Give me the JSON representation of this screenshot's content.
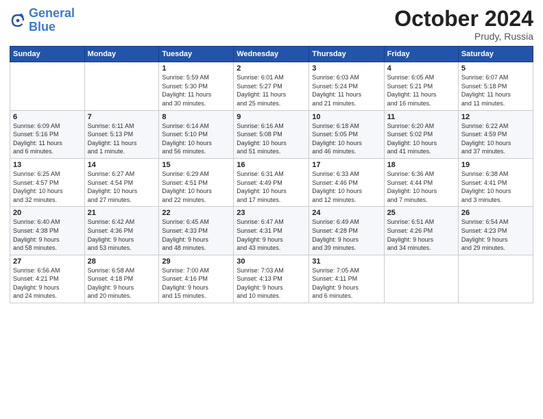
{
  "logo": {
    "line1": "General",
    "line2": "Blue"
  },
  "title": "October 2024",
  "location": "Prudy, Russia",
  "days_header": [
    "Sunday",
    "Monday",
    "Tuesday",
    "Wednesday",
    "Thursday",
    "Friday",
    "Saturday"
  ],
  "weeks": [
    [
      {
        "day": "",
        "info": ""
      },
      {
        "day": "",
        "info": ""
      },
      {
        "day": "1",
        "info": "Sunrise: 5:59 AM\nSunset: 5:30 PM\nDaylight: 11 hours\nand 30 minutes."
      },
      {
        "day": "2",
        "info": "Sunrise: 6:01 AM\nSunset: 5:27 PM\nDaylight: 11 hours\nand 25 minutes."
      },
      {
        "day": "3",
        "info": "Sunrise: 6:03 AM\nSunset: 5:24 PM\nDaylight: 11 hours\nand 21 minutes."
      },
      {
        "day": "4",
        "info": "Sunrise: 6:05 AM\nSunset: 5:21 PM\nDaylight: 11 hours\nand 16 minutes."
      },
      {
        "day": "5",
        "info": "Sunrise: 6:07 AM\nSunset: 5:18 PM\nDaylight: 11 hours\nand 11 minutes."
      }
    ],
    [
      {
        "day": "6",
        "info": "Sunrise: 6:09 AM\nSunset: 5:16 PM\nDaylight: 11 hours\nand 6 minutes."
      },
      {
        "day": "7",
        "info": "Sunrise: 6:11 AM\nSunset: 5:13 PM\nDaylight: 11 hours\nand 1 minute."
      },
      {
        "day": "8",
        "info": "Sunrise: 6:14 AM\nSunset: 5:10 PM\nDaylight: 10 hours\nand 56 minutes."
      },
      {
        "day": "9",
        "info": "Sunrise: 6:16 AM\nSunset: 5:08 PM\nDaylight: 10 hours\nand 51 minutes."
      },
      {
        "day": "10",
        "info": "Sunrise: 6:18 AM\nSunset: 5:05 PM\nDaylight: 10 hours\nand 46 minutes."
      },
      {
        "day": "11",
        "info": "Sunrise: 6:20 AM\nSunset: 5:02 PM\nDaylight: 10 hours\nand 41 minutes."
      },
      {
        "day": "12",
        "info": "Sunrise: 6:22 AM\nSunset: 4:59 PM\nDaylight: 10 hours\nand 37 minutes."
      }
    ],
    [
      {
        "day": "13",
        "info": "Sunrise: 6:25 AM\nSunset: 4:57 PM\nDaylight: 10 hours\nand 32 minutes."
      },
      {
        "day": "14",
        "info": "Sunrise: 6:27 AM\nSunset: 4:54 PM\nDaylight: 10 hours\nand 27 minutes."
      },
      {
        "day": "15",
        "info": "Sunrise: 6:29 AM\nSunset: 4:51 PM\nDaylight: 10 hours\nand 22 minutes."
      },
      {
        "day": "16",
        "info": "Sunrise: 6:31 AM\nSunset: 4:49 PM\nDaylight: 10 hours\nand 17 minutes."
      },
      {
        "day": "17",
        "info": "Sunrise: 6:33 AM\nSunset: 4:46 PM\nDaylight: 10 hours\nand 12 minutes."
      },
      {
        "day": "18",
        "info": "Sunrise: 6:36 AM\nSunset: 4:44 PM\nDaylight: 10 hours\nand 7 minutes."
      },
      {
        "day": "19",
        "info": "Sunrise: 6:38 AM\nSunset: 4:41 PM\nDaylight: 10 hours\nand 3 minutes."
      }
    ],
    [
      {
        "day": "20",
        "info": "Sunrise: 6:40 AM\nSunset: 4:38 PM\nDaylight: 9 hours\nand 58 minutes."
      },
      {
        "day": "21",
        "info": "Sunrise: 6:42 AM\nSunset: 4:36 PM\nDaylight: 9 hours\nand 53 minutes."
      },
      {
        "day": "22",
        "info": "Sunrise: 6:45 AM\nSunset: 4:33 PM\nDaylight: 9 hours\nand 48 minutes."
      },
      {
        "day": "23",
        "info": "Sunrise: 6:47 AM\nSunset: 4:31 PM\nDaylight: 9 hours\nand 43 minutes."
      },
      {
        "day": "24",
        "info": "Sunrise: 6:49 AM\nSunset: 4:28 PM\nDaylight: 9 hours\nand 39 minutes."
      },
      {
        "day": "25",
        "info": "Sunrise: 6:51 AM\nSunset: 4:26 PM\nDaylight: 9 hours\nand 34 minutes."
      },
      {
        "day": "26",
        "info": "Sunrise: 6:54 AM\nSunset: 4:23 PM\nDaylight: 9 hours\nand 29 minutes."
      }
    ],
    [
      {
        "day": "27",
        "info": "Sunrise: 6:56 AM\nSunset: 4:21 PM\nDaylight: 9 hours\nand 24 minutes."
      },
      {
        "day": "28",
        "info": "Sunrise: 6:58 AM\nSunset: 4:18 PM\nDaylight: 9 hours\nand 20 minutes."
      },
      {
        "day": "29",
        "info": "Sunrise: 7:00 AM\nSunset: 4:16 PM\nDaylight: 9 hours\nand 15 minutes."
      },
      {
        "day": "30",
        "info": "Sunrise: 7:03 AM\nSunset: 4:13 PM\nDaylight: 9 hours\nand 10 minutes."
      },
      {
        "day": "31",
        "info": "Sunrise: 7:05 AM\nSunset: 4:11 PM\nDaylight: 9 hours\nand 6 minutes."
      },
      {
        "day": "",
        "info": ""
      },
      {
        "day": "",
        "info": ""
      }
    ]
  ]
}
